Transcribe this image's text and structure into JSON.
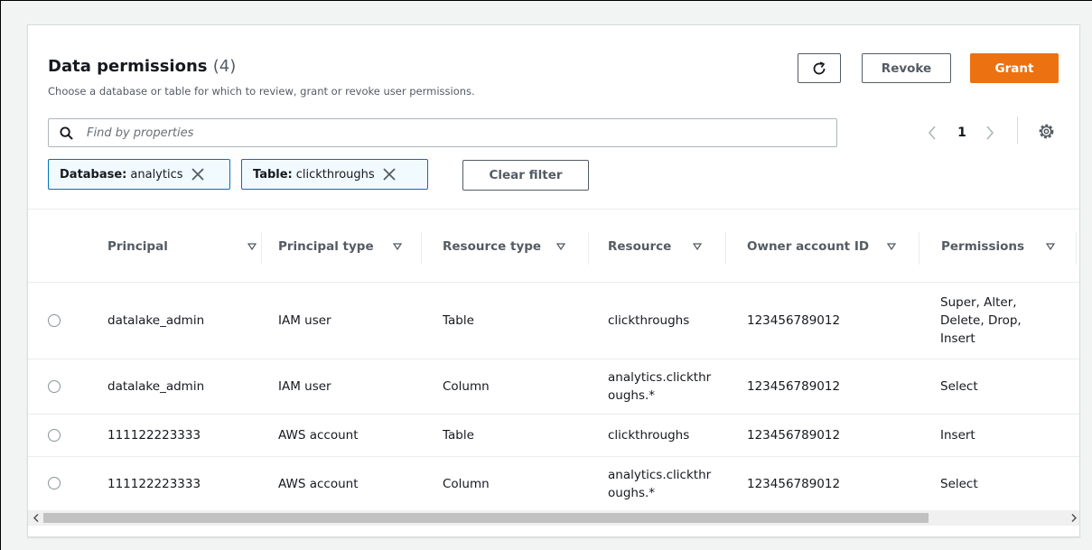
{
  "header": {
    "title": "Data permissions",
    "count": "(4)",
    "description": "Choose a database or table for which to review, grant or revoke user permissions."
  },
  "actions": {
    "revoke_label": "Revoke",
    "grant_label": "Grant"
  },
  "search": {
    "placeholder": "Find by properties"
  },
  "pagination": {
    "current_page": "1"
  },
  "filters": [
    {
      "key": "Database:",
      "value": "analytics"
    },
    {
      "key": "Table:",
      "value": "clickthroughs"
    }
  ],
  "clear_filter_label": "Clear filter",
  "table": {
    "columns": [
      "Principal",
      "Principal type",
      "Resource type",
      "Resource",
      "Owner account ID",
      "Permissions"
    ],
    "rows": [
      {
        "principal": "datalake_admin",
        "principal_type": "IAM user",
        "resource_type": "Table",
        "resource": "clickthroughs",
        "owner_account_id": "123456789012",
        "permissions": "Super, Alter, Delete, Drop, Insert"
      },
      {
        "principal": "datalake_admin",
        "principal_type": "IAM user",
        "resource_type": "Column",
        "resource": "analytics.clickthroughs.*",
        "owner_account_id": "123456789012",
        "permissions": "Select"
      },
      {
        "principal": "111122223333",
        "principal_type": "AWS account",
        "resource_type": "Table",
        "resource": "clickthroughs",
        "owner_account_id": "123456789012",
        "permissions": "Insert"
      },
      {
        "principal": "111122223333",
        "principal_type": "AWS account",
        "resource_type": "Column",
        "resource": "analytics.clickthroughs.*",
        "owner_account_id": "123456789012",
        "permissions": "Select"
      }
    ]
  },
  "colors": {
    "accent": "#ec7211",
    "filter_border": "#0073bb",
    "filter_bg": "#f1faff",
    "text": "#16191f",
    "muted": "#545b64"
  },
  "icons": [
    "refresh-icon",
    "search-icon",
    "chevron-left-icon",
    "chevron-right-icon",
    "settings-icon",
    "close-icon",
    "sort-icon",
    "radio-button"
  ]
}
